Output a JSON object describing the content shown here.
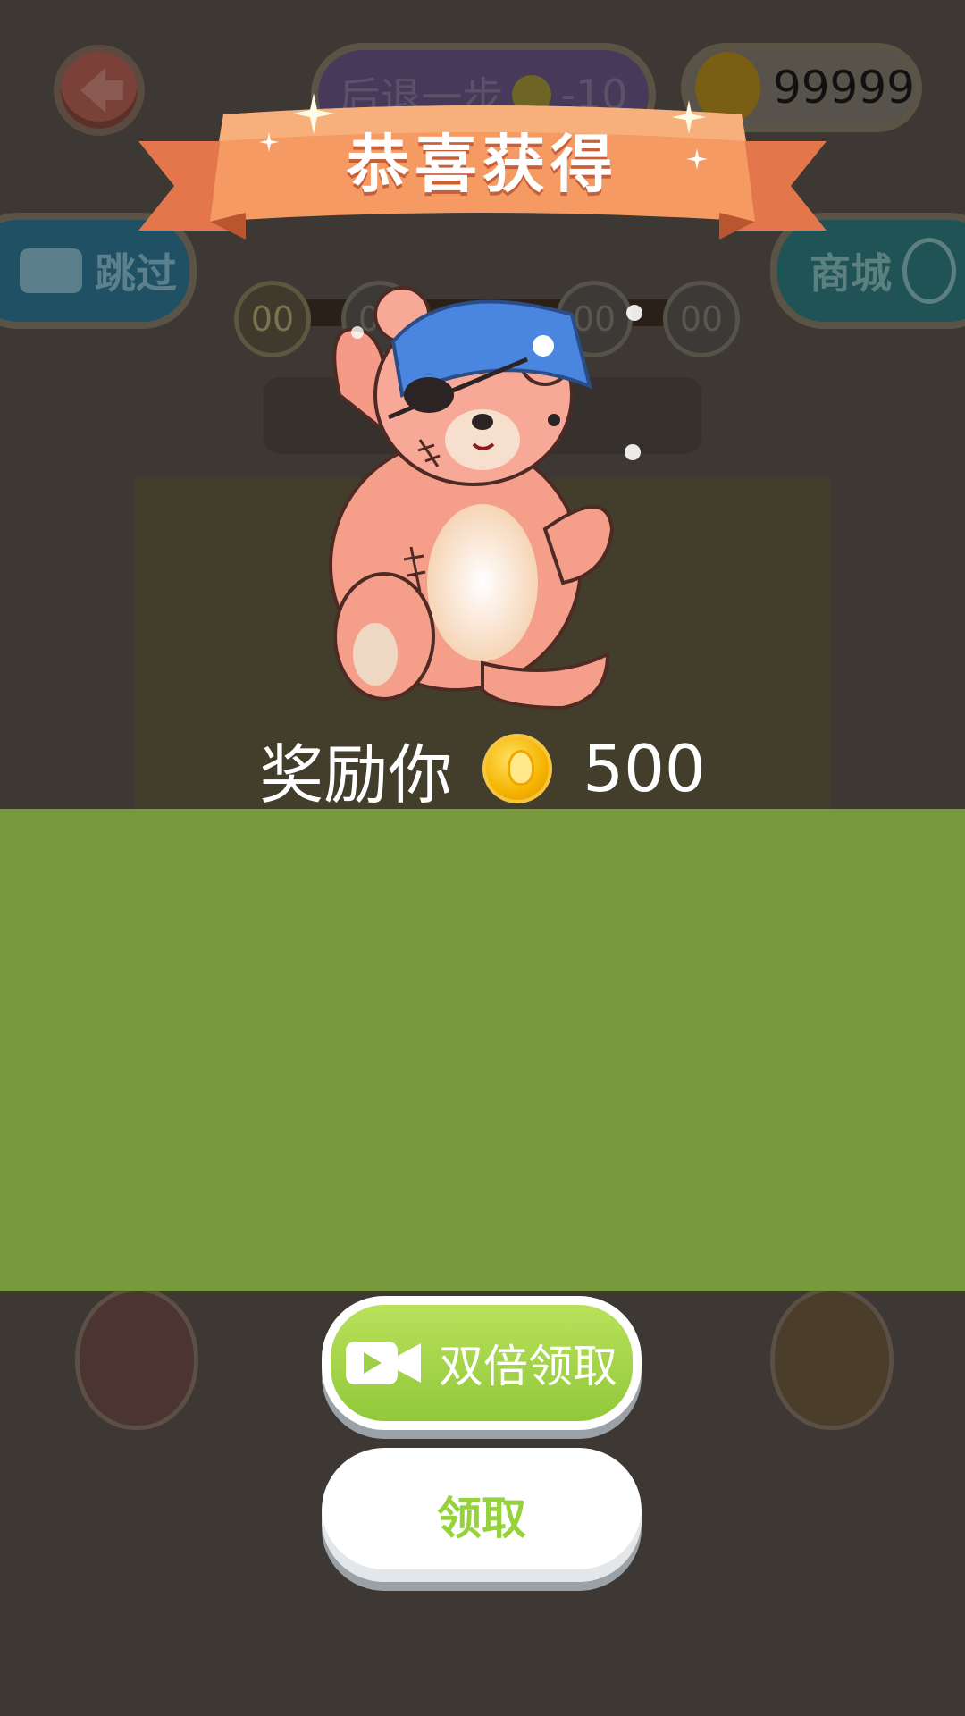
{
  "hud": {
    "undo_label": "后退一步",
    "undo_cost": "-10",
    "coin_balance": "99999",
    "skip_label": "跳过",
    "shop_label": "商城",
    "progress_counters": [
      "00",
      "00",
      "00",
      "00"
    ]
  },
  "popup": {
    "title": "恭喜获得",
    "reward_text": "奖励你",
    "reward_amount": "500",
    "double_claim_label": "双倍领取",
    "claim_label": "领取"
  },
  "colors": {
    "ribbon": "#f08a55",
    "overlay_green": "#789a3c",
    "overlay_dark": "#433e2b",
    "button_green": "#a6d64a",
    "claim_text": "#95d23c"
  },
  "icons": [
    "back-arrow-icon",
    "coin-icon",
    "video-camera-icon",
    "balloon-icon",
    "sparkle-icon",
    "teddy-bear-image"
  ]
}
